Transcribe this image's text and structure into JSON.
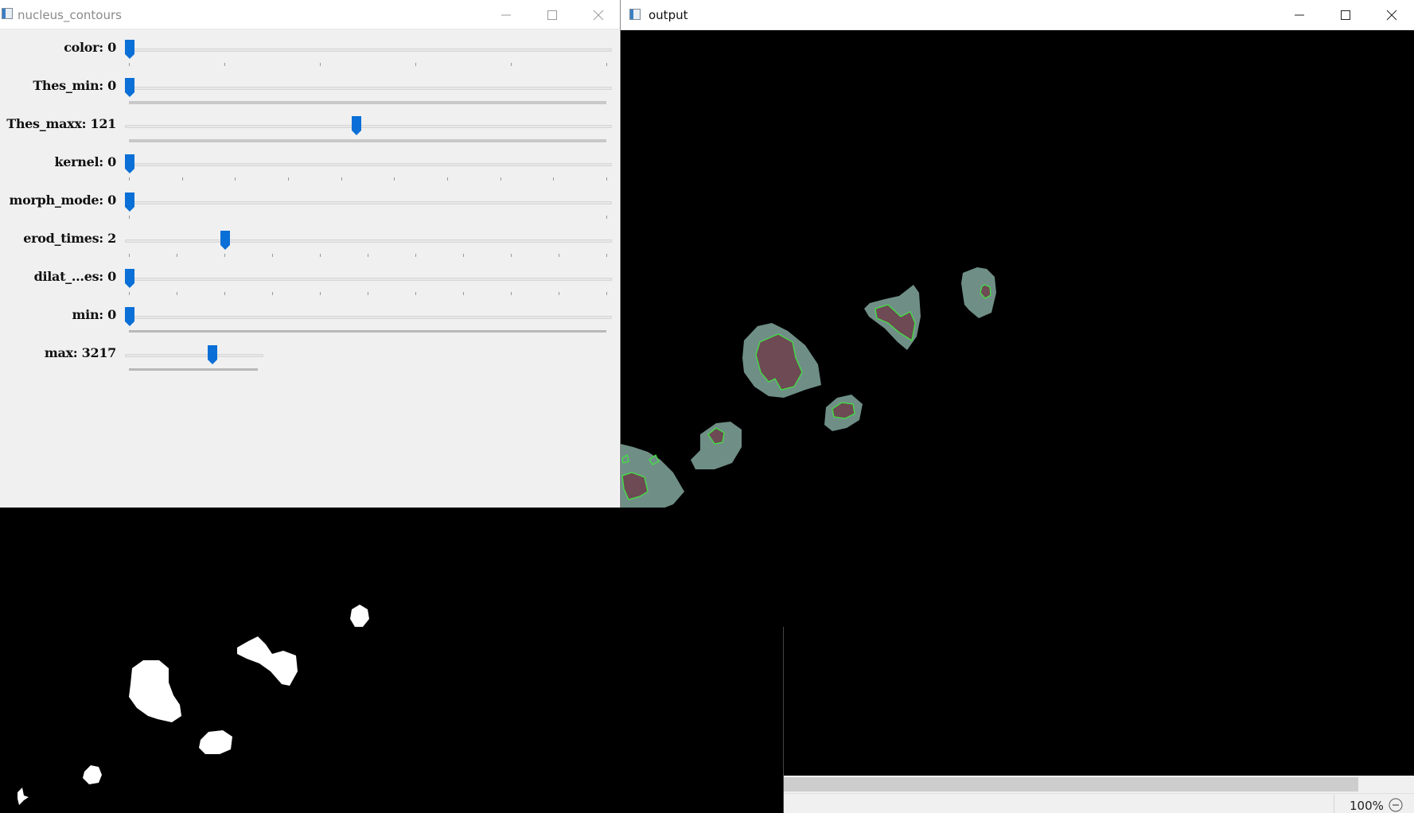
{
  "windows": {
    "left": {
      "title": "nucleus_contours",
      "buttons": [
        "minimize",
        "maximize",
        "close"
      ]
    },
    "right": {
      "title": "output",
      "buttons": [
        "minimize",
        "maximize",
        "close"
      ]
    }
  },
  "trackbars": [
    {
      "label": "color: 0",
      "value": 0,
      "max": 5
    },
    {
      "label": "Thes_min: 0",
      "value": 0,
      "max": 255
    },
    {
      "label": "Thes_maxx: 121",
      "value": 121,
      "max": 255
    },
    {
      "label": "kernel: 0",
      "value": 0,
      "max": 9
    },
    {
      "label": "morph_mode: 0",
      "value": 0,
      "max": 1
    },
    {
      "label": "erod_times: 2",
      "value": 2,
      "max": 10
    },
    {
      "label": "dilat_...es: 0",
      "value": 0,
      "max": 10
    },
    {
      "label": "min: 0",
      "value": 0,
      "max": 10000
    },
    {
      "label": "max: 3217",
      "value": 3217,
      "max": 5000
    }
  ],
  "status": {
    "zoom": "100%"
  },
  "colors": {
    "accent": "#0a6fd6",
    "contour": "#3ee83e",
    "cell": "#6f8f86",
    "nucleus": "#6e4a55"
  }
}
